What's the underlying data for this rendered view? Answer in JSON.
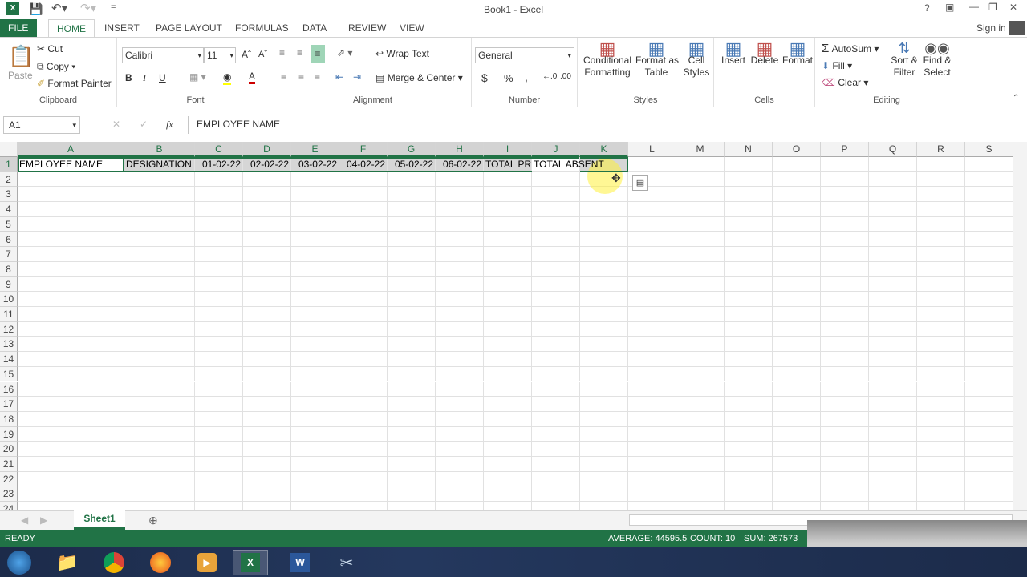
{
  "window": {
    "title": "Book1 - Excel",
    "signin": "Sign in"
  },
  "tabs": [
    "FILE",
    "HOME",
    "INSERT",
    "PAGE LAYOUT",
    "FORMULAS",
    "DATA",
    "REVIEW",
    "VIEW"
  ],
  "ribbon": {
    "clipboard": {
      "label": "Clipboard",
      "paste": "Paste",
      "cut": "Cut",
      "copy": "Copy",
      "format_painter": "Format Painter"
    },
    "font": {
      "label": "Font",
      "name": "Calibri",
      "size": "11",
      "bold": "B",
      "italic": "I",
      "underline": "U"
    },
    "alignment": {
      "label": "Alignment",
      "wrap": "Wrap Text",
      "merge": "Merge & Center"
    },
    "number": {
      "label": "Number",
      "format": "General",
      "currency": "$",
      "percent": "%",
      "comma": ","
    },
    "styles": {
      "label": "Styles",
      "conditional": [
        "Conditional",
        "Formatting"
      ],
      "table": [
        "Format as",
        "Table"
      ],
      "cell": [
        "Cell",
        "Styles"
      ]
    },
    "cells": {
      "label": "Cells",
      "insert": "Insert",
      "delete": "Delete",
      "format": "Format"
    },
    "editing": {
      "label": "Editing",
      "autosum": "AutoSum",
      "fill": "Fill",
      "clear": "Clear",
      "sort": [
        "Sort &",
        "Filter"
      ],
      "find": [
        "Find &",
        "Select"
      ]
    }
  },
  "formula_bar": {
    "name_box": "A1",
    "fx": "fx",
    "value": "EMPLOYEE NAME"
  },
  "columns": [
    "A",
    "B",
    "C",
    "D",
    "E",
    "F",
    "G",
    "H",
    "I",
    "J",
    "K",
    "L",
    "M",
    "N",
    "O",
    "P",
    "Q",
    "R",
    "S"
  ],
  "rows": [
    "1",
    "2",
    "3",
    "4",
    "5",
    "6",
    "7",
    "8",
    "9",
    "10",
    "11",
    "12",
    "13",
    "14",
    "15",
    "16",
    "17",
    "18",
    "19",
    "20",
    "21",
    "22",
    "23",
    "24"
  ],
  "row1": [
    "EMPLOYEE NAME",
    "DESIGNATION",
    "01-02-22",
    "02-02-22",
    "03-02-22",
    "04-02-22",
    "05-02-22",
    "06-02-22",
    "TOTAL PRI",
    "TOTAL ABSENT"
  ],
  "sheet": {
    "name": "Sheet1"
  },
  "status": {
    "ready": "READY",
    "average": "AVERAGE: 44595.5",
    "count": "COUNT: 10",
    "sum": "SUM: 267573"
  },
  "colors": {
    "accent": "#217346"
  }
}
